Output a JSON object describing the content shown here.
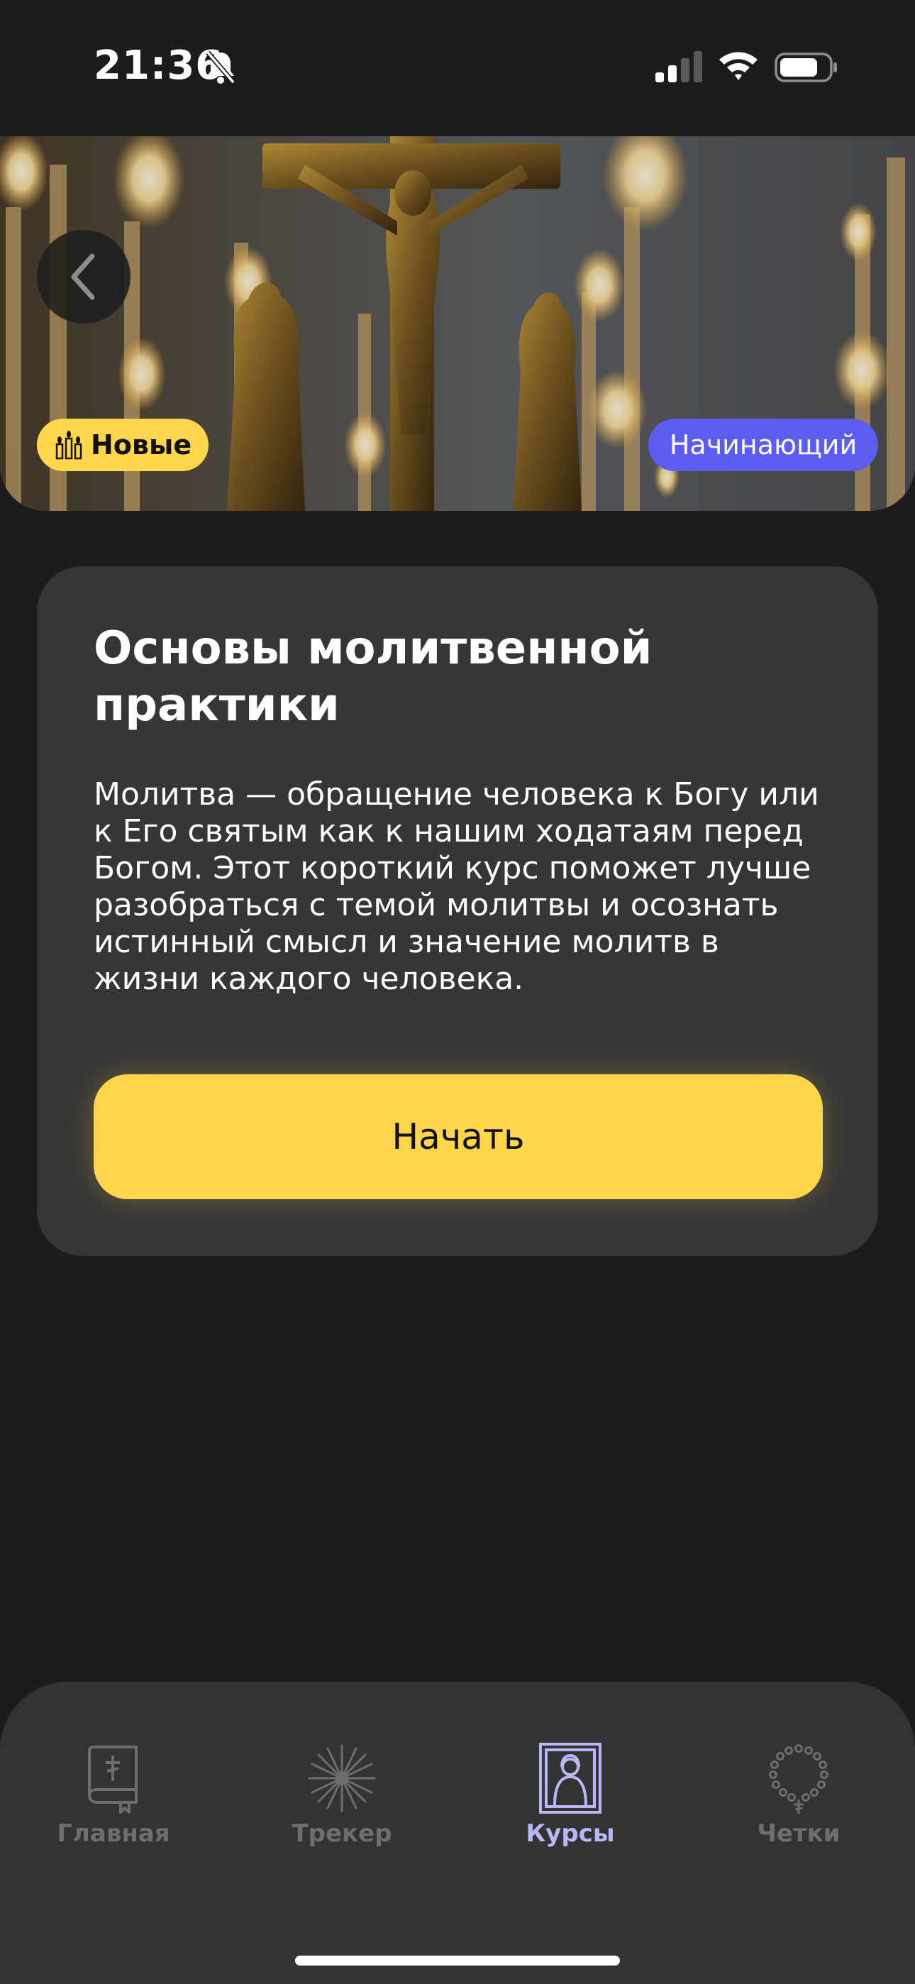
{
  "status_bar": {
    "time": "21:36",
    "icons": [
      "bell-slash-icon",
      "cellular-signal-icon",
      "wifi-icon",
      "battery-icon"
    ]
  },
  "hero": {
    "image": "candles-crucifix-photo",
    "back_icon": "chevron-left-icon",
    "badge_new": {
      "icon": "candles-icon",
      "label": "Новые",
      "color": "#ffd54a"
    },
    "badge_level": {
      "label": "Начинающий",
      "color": "#5b5cf0"
    }
  },
  "course": {
    "title": "Основы молитвенной практики",
    "description": "Молитва — обращение человека к Богу или к Его святым как к нашим ходатаям перед Богом. Этот короткий курс поможет лучше разобраться с темой молитвы и осознать истинный смысл и значение молитв в жизни каждого человека.",
    "start_label": "Начать",
    "accent_color": "#ffd54a"
  },
  "tabs": [
    {
      "id": "home",
      "label": "Главная",
      "icon": "bible-cross-icon",
      "active": false
    },
    {
      "id": "tracker",
      "label": "Трекер",
      "icon": "sunburst-icon",
      "active": false
    },
    {
      "id": "courses",
      "label": "Курсы",
      "icon": "icon-frame-icon",
      "active": true
    },
    {
      "id": "rosary",
      "label": "Четки",
      "icon": "prayer-beads-icon",
      "active": false
    }
  ],
  "active_tab_color": "#b8b8f6"
}
